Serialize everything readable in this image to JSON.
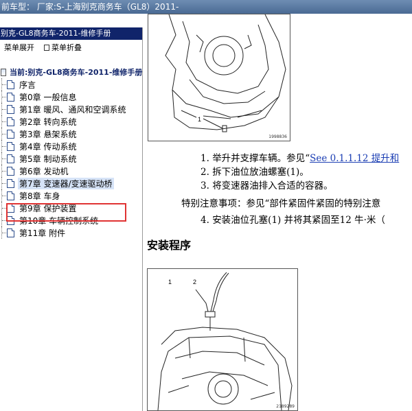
{
  "titlebar": {
    "text": "前车型：  厂家:S-上海别克商务车（GL8）2011-"
  },
  "left": {
    "header": "别克-GL8商务车-2011-维修手册",
    "toolbar": {
      "expand_label": "菜单展开",
      "collapse_label": "菜单折叠"
    },
    "root_label": "当前:别克-GL8商务车-2011-维修手册",
    "items": [
      {
        "label": "序言"
      },
      {
        "label": "第0章  一般信息"
      },
      {
        "label": "第1章  暖风、通风和空调系统"
      },
      {
        "label": "第2章  转向系统"
      },
      {
        "label": "第3章  悬架系统"
      },
      {
        "label": "第4章  传动系统"
      },
      {
        "label": "第5章  制动系统"
      },
      {
        "label": "第6章  发动机"
      },
      {
        "label": "第7章  变速器/变速驱动桥"
      },
      {
        "label": "第8章  车身"
      },
      {
        "label": "第9章  保护装置"
      },
      {
        "label": "第10章  车辆控制系统"
      },
      {
        "label": "第11章  附件"
      }
    ],
    "selected_index": 8
  },
  "content": {
    "figure1": {
      "callout": "1",
      "code": "1998836"
    },
    "steps": [
      {
        "num": "1.",
        "text": "举升并支撑车辆。参见",
        "quote": "“",
        "link": "See 0.1.1.12 提升和"
      },
      {
        "num": "2.",
        "text": "拆下油位放油螺塞(1)。"
      },
      {
        "num": "3.",
        "text": "将变速器油排入合适的容器。"
      }
    ],
    "notice": "特别注意事项：参见“部件紧固件紧固的特别注意",
    "step4": {
      "num": "4.",
      "text": "安装油位孔塞(1) 并将其紧固至12 牛·米（"
    },
    "section_title": "安装程序",
    "figure2": {
      "callout1": "1",
      "callout2": "2",
      "code": "2189289"
    }
  },
  "colors": {
    "titlebar": "#5a7aa3",
    "left_header": "#10246a",
    "highlight": "#e03232",
    "link": "#1a3db3"
  }
}
